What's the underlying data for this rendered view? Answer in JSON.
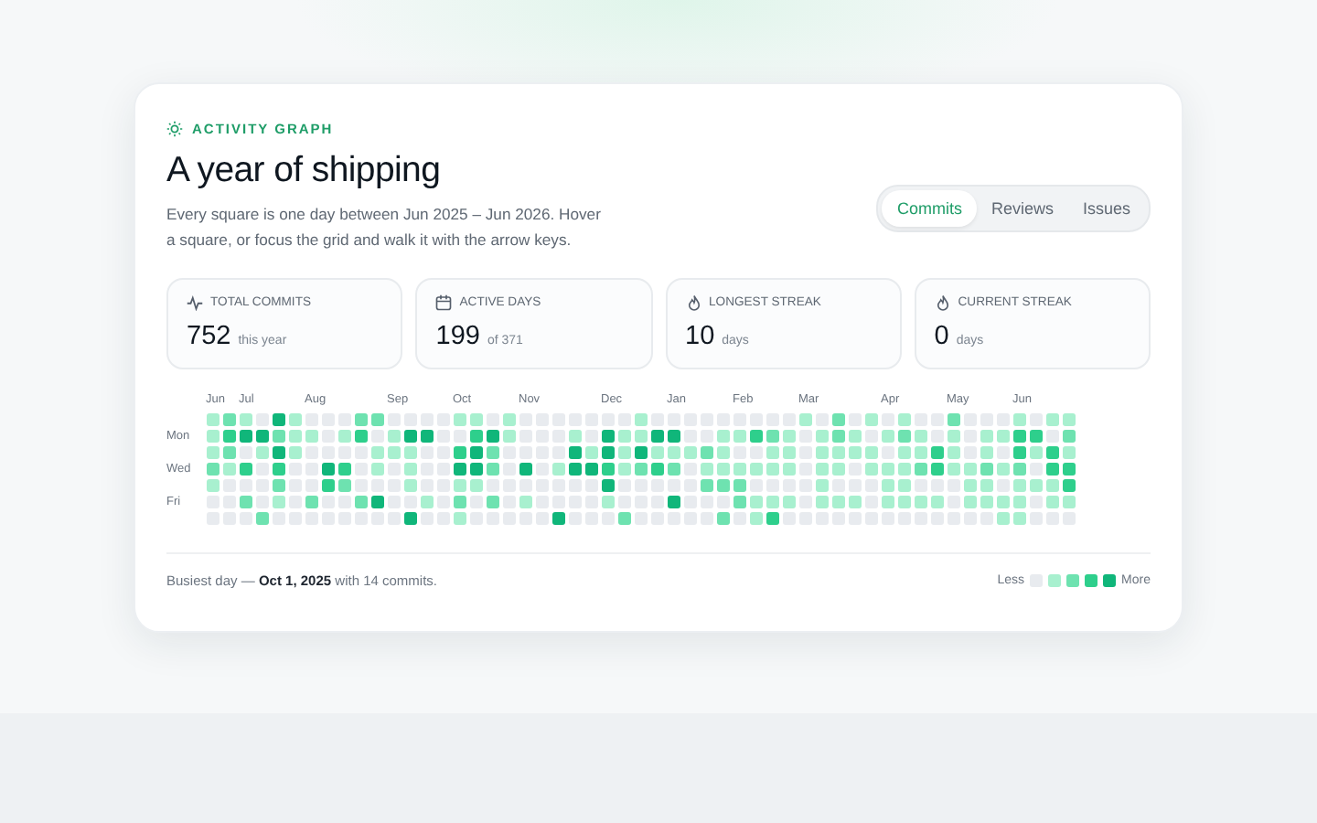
{
  "card": {
    "eyebrow": "ACTIVITY GRAPH",
    "title": "A year of shipping",
    "description": "Every square is one day between Jun 2025 – Jun 2026. Hover a square, or focus the grid and walk it with the arrow keys."
  },
  "tabs": [
    {
      "label": "Commits",
      "selected": true
    },
    {
      "label": "Reviews",
      "selected": false
    },
    {
      "label": "Issues",
      "selected": false
    }
  ],
  "stats": [
    {
      "kind": "pulse",
      "label": "TOTAL COMMITS",
      "value": "752",
      "note": "this year"
    },
    {
      "kind": "calendar",
      "label": "ACTIVE DAYS",
      "value": "199",
      "note": "of 371"
    },
    {
      "kind": "flame",
      "label": "LONGEST STREAK",
      "value": "10",
      "note": "days"
    },
    {
      "kind": "flame",
      "label": "CURRENT STREAK",
      "value": "0",
      "note": "days"
    }
  ],
  "day_labels": [
    "Mon",
    "Wed",
    "Fri"
  ],
  "month_labels": [
    "Jun",
    "Jul",
    "Aug",
    "Sep",
    "Oct",
    "Nov",
    "Dec",
    "Jan",
    "Feb",
    "Mar",
    "Apr",
    "May",
    "Jun"
  ],
  "footer": {
    "summary": "Busiest day — **Oct 1, 2025** with 14 commits.",
    "legend_less": "Less",
    "legend_more": "More"
  }
}
